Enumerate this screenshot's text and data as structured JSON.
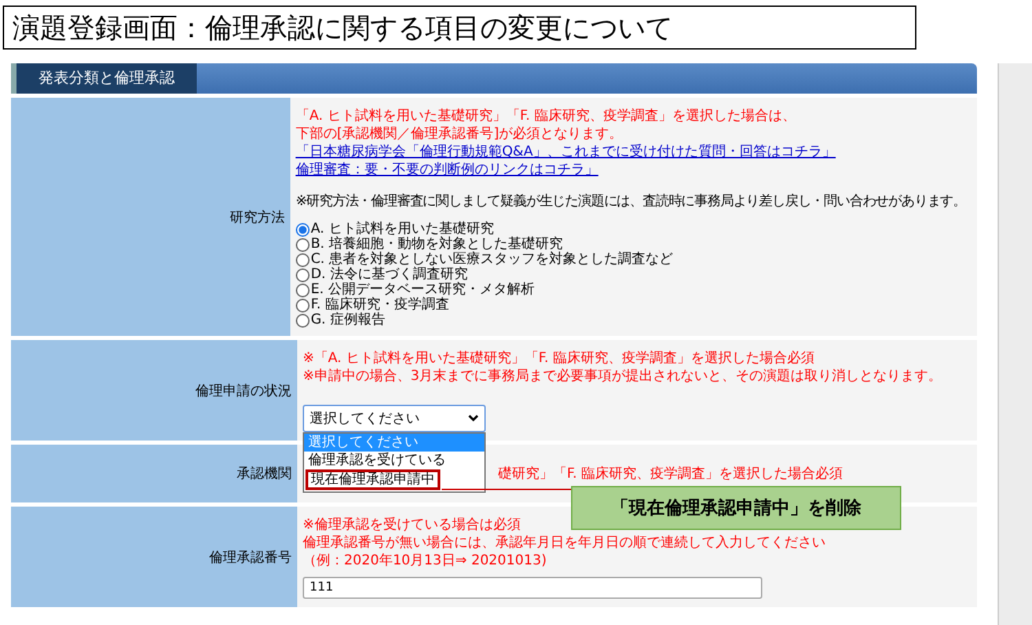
{
  "title": "演題登録画面：倫理承認に関する項目の変更について",
  "section": {
    "header": "発表分類と倫理承認"
  },
  "rows": [
    {
      "kind": "radio",
      "label": "研究方法",
      "lines": [
        {
          "kind": "warning",
          "text": "「A. ヒト試料を用いた基礎研究」「F. 臨床研究、疫学調査」を選択した場合は、"
        },
        {
          "kind": "warning",
          "text": "下部の[承認機関／倫理承認番号]が必須となります。"
        },
        {
          "kind": "link",
          "text": "「日本糖尿病学会「倫理行動規範Q&A」、これまでに受け付けた質問・回答はコチラ」"
        },
        {
          "kind": "link",
          "text": "倫理審査：要・不要の判断例のリンクはコチラ」"
        },
        {
          "kind": "note",
          "text": "※研究方法・倫理審査に関しまして疑義が生じた演題には、査読時に事務局より差し戻し・問い合わせがあります。"
        }
      ],
      "options": [
        {
          "label": "A. ヒト試料を用いた基礎研究",
          "selected": true
        },
        {
          "label": "B. 培養細胞・動物を対象とした基礎研究",
          "selected": false
        },
        {
          "label": "C. 患者を対象としない医療スタッフを対象とした調査など",
          "selected": false
        },
        {
          "label": "D. 法令に基づく調査研究",
          "selected": false
        },
        {
          "label": "E. 公開データベース研究・メタ解析",
          "selected": false
        },
        {
          "label": "F. 臨床研究・疫学調査",
          "selected": false
        },
        {
          "label": "G. 症例報告",
          "selected": false
        }
      ]
    },
    {
      "kind": "select",
      "label": "倫理申請の状況",
      "lines": [
        {
          "kind": "warning",
          "text": "※「A. ヒト試料を用いた基礎研究」「F. 臨床研究、疫学調査」を選択した場合必須"
        },
        {
          "kind": "warning",
          "text": "※申請中の場合、3月末までに事務局まで必要事項が提出されないと、その演題は取り消しとなります。"
        }
      ],
      "select": {
        "value": "選択してください",
        "expanded": true,
        "options": [
          {
            "label": "選択してください",
            "highlighted": true,
            "marked": false
          },
          {
            "label": "倫理承認を受けている",
            "highlighted": false,
            "marked": false
          },
          {
            "label": "現在倫理承認申請中",
            "highlighted": false,
            "marked": true
          }
        ]
      },
      "callout": {
        "text": "「現在倫理承認申請中」を削除"
      }
    },
    {
      "kind": "partial",
      "label": "承認機関",
      "lines": [
        {
          "kind": "warning",
          "text": "礎研究」「F. 臨床研究、疫学調査」を選択した場合必須"
        }
      ]
    },
    {
      "kind": "input",
      "label": "倫理承認番号",
      "lines": [
        {
          "kind": "warning",
          "text": "※倫理承認を受けている場合は必須"
        },
        {
          "kind": "warning",
          "text": "倫理承認番号が無い場合には、承認年月日を年月日の順で連続して入力してください"
        },
        {
          "kind": "warning",
          "text": "（例：2020年10月13日⇒ 20201013)"
        }
      ],
      "value": "111"
    }
  ]
}
